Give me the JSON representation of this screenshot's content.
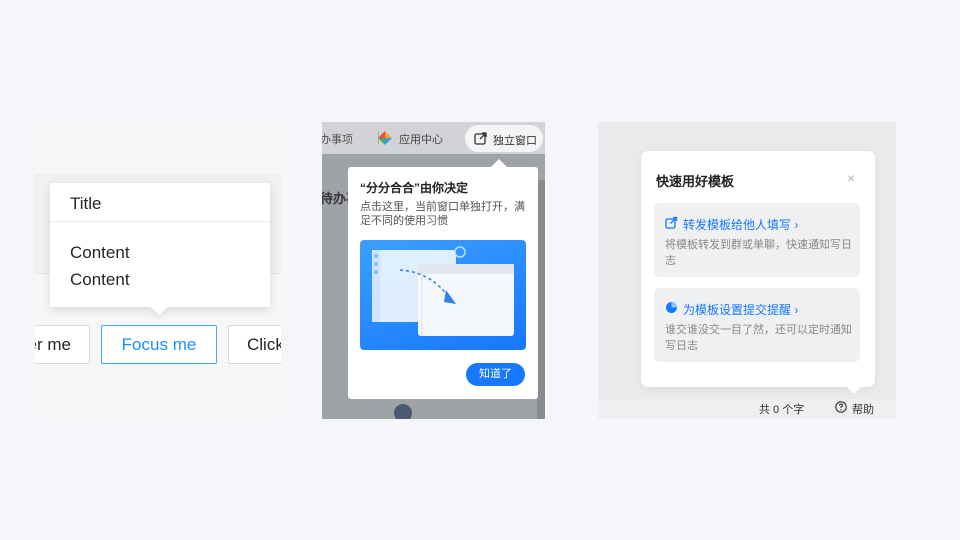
{
  "panel1": {
    "popover_title": "Title",
    "popover_content": [
      "Content",
      "Content"
    ],
    "buttons": [
      "Hover me",
      "Focus me",
      "Click me"
    ]
  },
  "panel2": {
    "topbar": {
      "todo": "办事项",
      "app_center": "应用中心",
      "window": "独立窗口"
    },
    "left_text": "待办事",
    "guide": {
      "title": "“分分合合”由你决定",
      "desc": "点击这里，当前窗口单独打开，满足不同的使用习惯",
      "button": "知道了"
    }
  },
  "panel3": {
    "card": {
      "title": "快速用好模板",
      "close": "×",
      "items": [
        {
          "label": "转发模板给他人填写",
          "chevron": "›",
          "desc": "将模板转发到群或单聊，快速通知写日志",
          "icon": "external-link-icon"
        },
        {
          "label": "为模板设置提交提醒",
          "chevron": "›",
          "desc": "谁交谁没交一目了然，还可以定时通知写日志",
          "icon": "pie-clock-icon"
        }
      ]
    },
    "status": {
      "count": "共 0 个字",
      "help": "帮助"
    }
  },
  "colors": {
    "accent": "#1677ff",
    "focus": "#1890ff"
  }
}
